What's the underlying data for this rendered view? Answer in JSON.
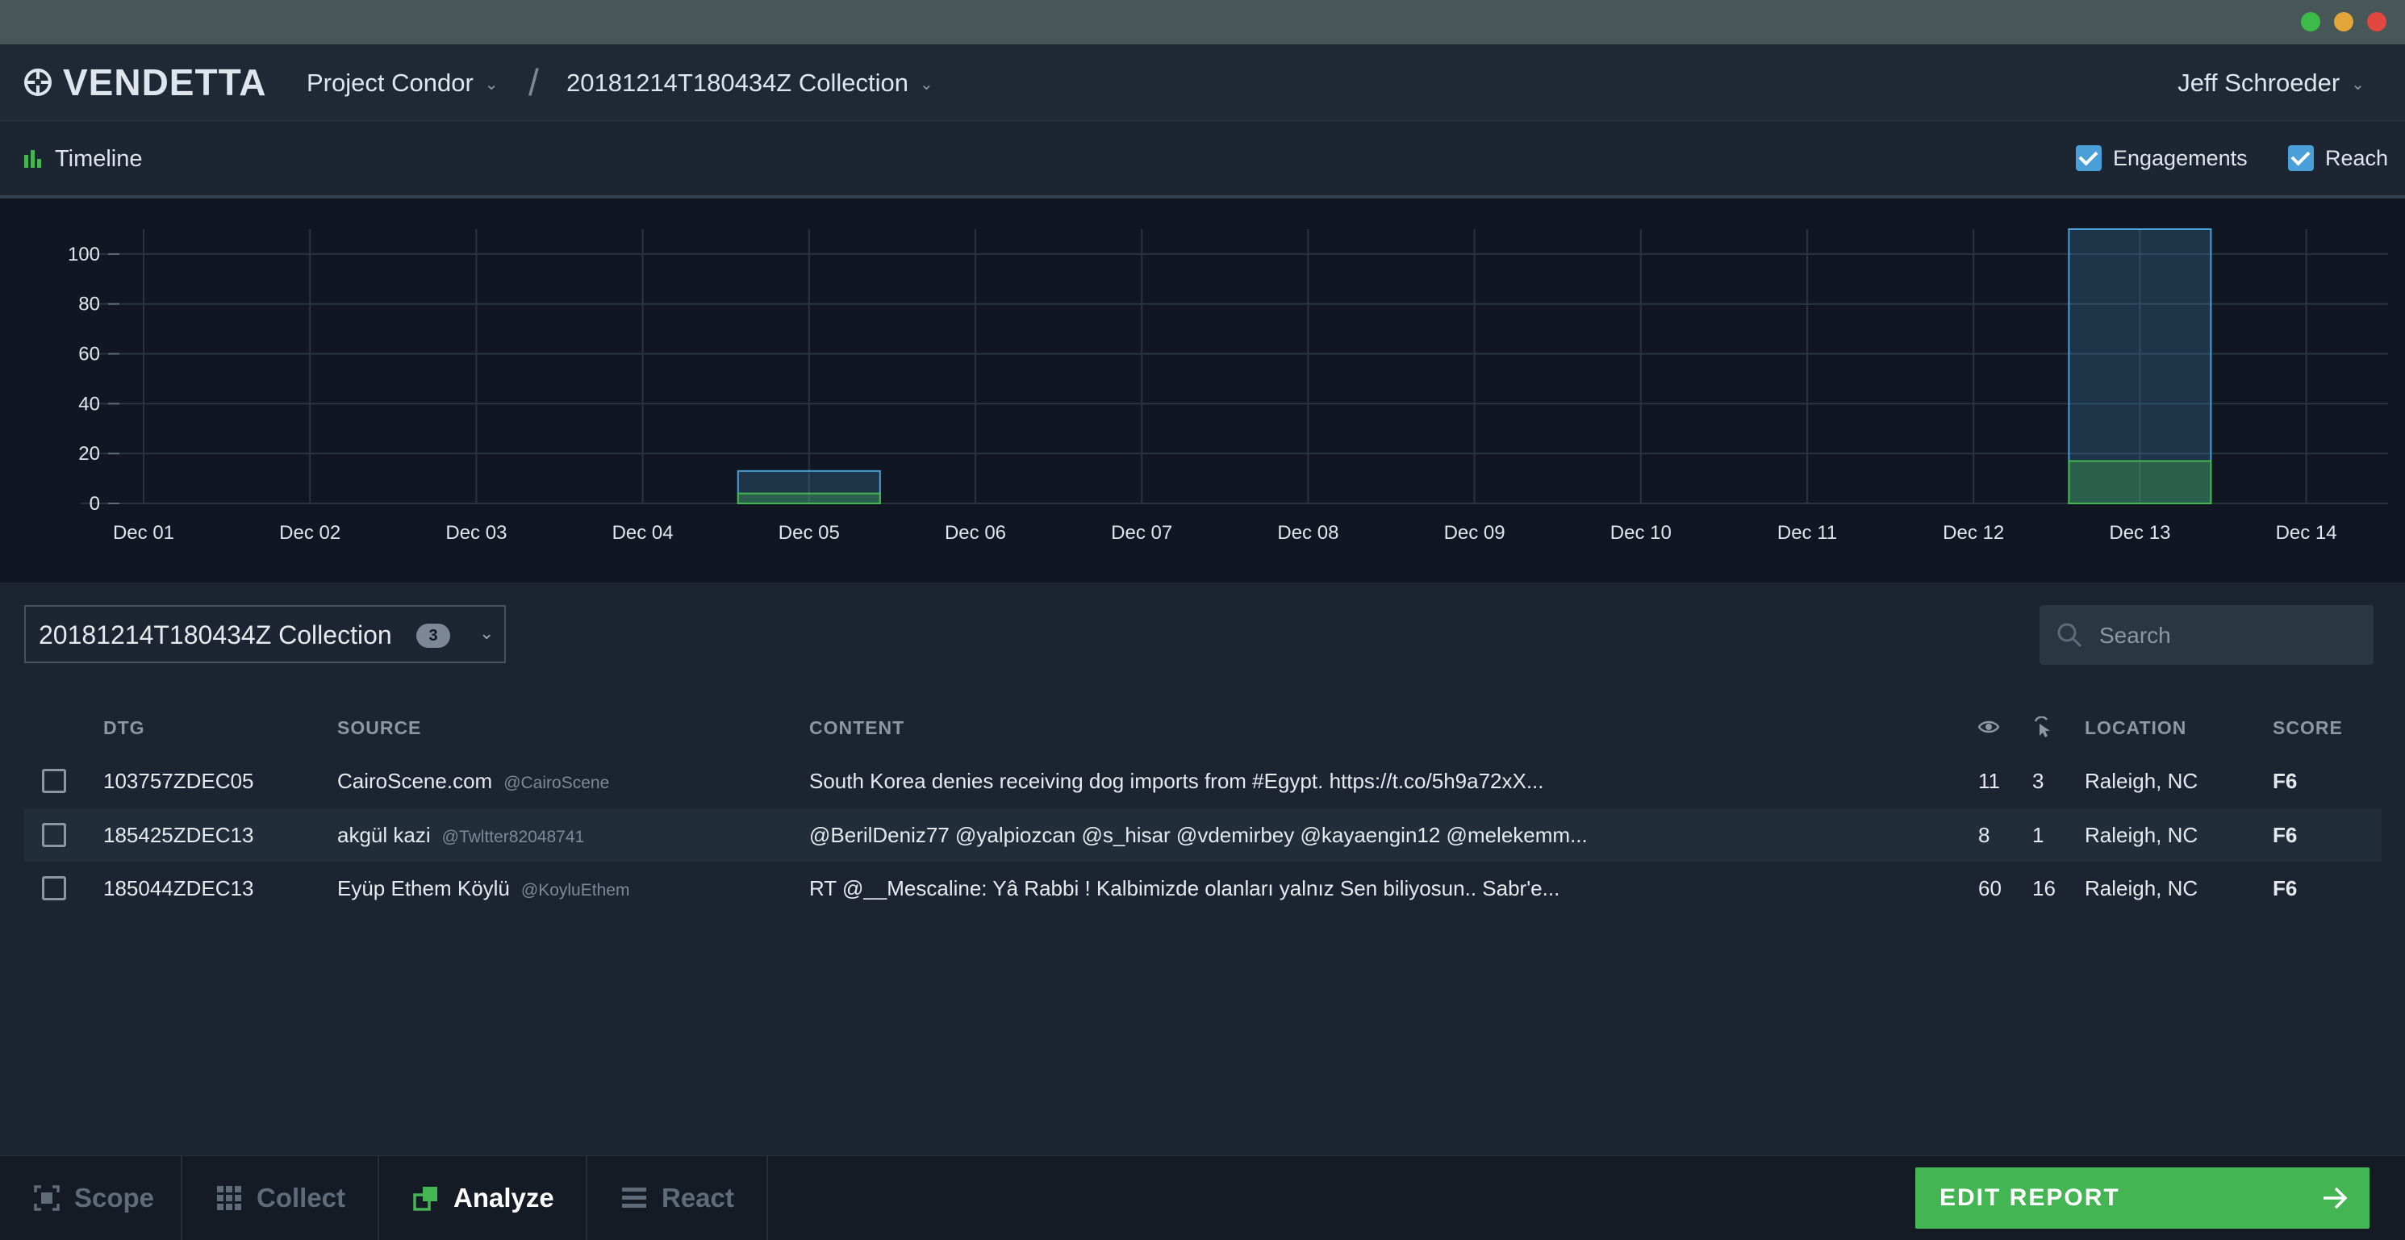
{
  "app": {
    "name": "VENDETTA"
  },
  "breadcrumb": {
    "project": "Project Condor",
    "collection": "20181214T180434Z Collection"
  },
  "user": {
    "name": "Jeff Schroeder"
  },
  "timeline": {
    "title": "Timeline",
    "legend": [
      {
        "label": "Engagements",
        "checked": true,
        "color": "#4b9fd8"
      },
      {
        "label": "Reach",
        "checked": true,
        "color": "#4b9fd8"
      }
    ]
  },
  "chart_data": {
    "type": "bar",
    "categories": [
      "Dec 01",
      "Dec 02",
      "Dec 03",
      "Dec 04",
      "Dec 05",
      "Dec 06",
      "Dec 07",
      "Dec 08",
      "Dec 09",
      "Dec 10",
      "Dec 11",
      "Dec 12",
      "Dec 13",
      "Dec 14"
    ],
    "series": [
      {
        "name": "Engagements",
        "color": "#44b553",
        "values": [
          0,
          0,
          0,
          0,
          4,
          0,
          0,
          0,
          0,
          0,
          0,
          0,
          17,
          0
        ]
      },
      {
        "name": "Reach",
        "color": "#4b9fd8",
        "values": [
          0,
          0,
          0,
          0,
          13,
          0,
          0,
          0,
          0,
          0,
          0,
          0,
          110,
          0
        ]
      }
    ],
    "yticks": [
      0,
      20,
      40,
      60,
      80,
      100
    ],
    "ylim": [
      0,
      110
    ],
    "stacked": false,
    "grid": true
  },
  "collection_select": {
    "label": "20181214T180434Z Collection",
    "count": "3"
  },
  "search": {
    "placeholder": "Search",
    "value": ""
  },
  "table": {
    "headers": {
      "dtg": "DTG",
      "source": "SOURCE",
      "content": "CONTENT",
      "views_icon": "eye-icon",
      "clicks_icon": "cursor-click-icon",
      "location": "LOCATION",
      "score": "SCORE"
    },
    "rows": [
      {
        "dtg": "103757ZDEC05",
        "source": "CairoScene.com",
        "handle": "@CairoScene",
        "content": "South Korea denies receiving dog imports from #Egypt. https://t.co/5h9a72xX...",
        "views": "11",
        "clicks": "3",
        "location": "Raleigh, NC",
        "score": "F6"
      },
      {
        "dtg": "185425ZDEC13",
        "source": "akgül kazi",
        "handle": "@Twltter82048741",
        "content": "@BerilDeniz77 @yalpiozcan @s_hisar @vdemirbey @kayaengin12 @melekemm...",
        "views": "8",
        "clicks": "1",
        "location": "Raleigh, NC",
        "score": "F6"
      },
      {
        "dtg": "185044ZDEC13",
        "source": "Eyüp Ethem Köylü",
        "handle": "@KoyluEthem",
        "content": "RT @__Mescaline: Yâ Rabbi ! Kalbimizde olanları yalnız Sen biliyosun.. Sabr'e...",
        "views": "60",
        "clicks": "16",
        "location": "Raleigh, NC",
        "score": "F6"
      }
    ]
  },
  "bottom_nav": {
    "tabs": [
      {
        "label": "Scope",
        "icon": "scope-icon",
        "active": false
      },
      {
        "label": "Collect",
        "icon": "grid-icon",
        "active": false
      },
      {
        "label": "Analyze",
        "icon": "analyze-icon",
        "active": true
      },
      {
        "label": "React",
        "icon": "list-icon",
        "active": false
      }
    ],
    "action": {
      "label": "EDIT REPORT",
      "icon": "arrow-right-icon"
    }
  },
  "colors": {
    "accent_green": "#44b553",
    "accent_blue": "#4b9fd8",
    "background": "#1b2430"
  }
}
